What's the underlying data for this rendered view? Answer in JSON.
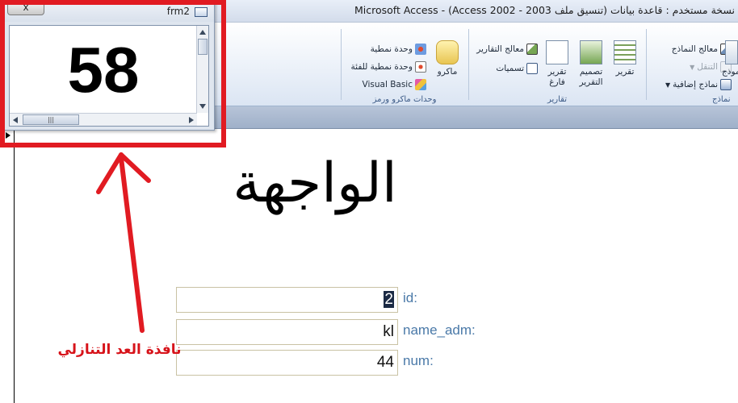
{
  "window": {
    "title_prefix": "نسخة مستخدم : قاعدة بيانات (تنسيق ملف Access 2002 - 2003)",
    "title_separator": " - ",
    "app_name": "Microsoft Access"
  },
  "ribbon": {
    "forms_group": {
      "caption": "نماذج",
      "items": [
        "معالج النماذج",
        "التنقل",
        "نماذج إضافية"
      ],
      "large_label_partial": "نموذج"
    },
    "reports_group": {
      "caption": "تقارير",
      "large": [
        "تقرير",
        "تصميم التقرير",
        "تقرير فارغ"
      ],
      "small": [
        "معالج التقارير",
        "تسميات"
      ]
    },
    "macros_group": {
      "caption": "وحدات ماكرو ورمز",
      "large": "ماكرو",
      "small": [
        "وحدة نمطية",
        "وحدة نمطية للفئة",
        "Visual Basic"
      ]
    }
  },
  "popup": {
    "close_label": "x",
    "form_name": "frm2",
    "counter_value": "58"
  },
  "form": {
    "heading": "الواجهة",
    "fields": [
      {
        "label": "id:",
        "value": "2"
      },
      {
        "label": "name_adm:",
        "value": "kl"
      },
      {
        "label": "num:",
        "value": "44"
      }
    ]
  },
  "annotation": {
    "text": "نافذة العد التنازلي",
    "color": "#e11b22"
  }
}
